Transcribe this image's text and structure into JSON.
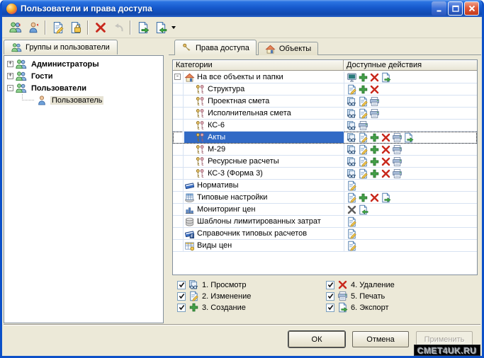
{
  "window": {
    "title": "Пользователи и права доступа"
  },
  "titlebar_buttons": [
    {
      "name": "minimize"
    },
    {
      "name": "maximize"
    },
    {
      "name": "close"
    }
  ],
  "toolbar": {
    "items": [
      {
        "icon": "add-group",
        "name": "add-group"
      },
      {
        "icon": "add-user",
        "name": "add-user"
      },
      {
        "type": "sep"
      },
      {
        "icon": "edit",
        "name": "edit-rights"
      },
      {
        "icon": "lock",
        "name": "lock-rights"
      },
      {
        "type": "sep"
      },
      {
        "icon": "delete",
        "name": "delete"
      },
      {
        "icon": "undo",
        "name": "undo",
        "disabled": true
      },
      {
        "type": "sep"
      },
      {
        "icon": "export",
        "name": "export"
      },
      {
        "icon": "import",
        "name": "import"
      },
      {
        "type": "arrow"
      }
    ]
  },
  "left_panel": {
    "tab": {
      "label": "Группы и пользователи",
      "icon": "users"
    },
    "tree": [
      {
        "label": "Администраторы",
        "icon": "users",
        "expander": "+",
        "level": 0,
        "bold": true
      },
      {
        "label": "Гости",
        "icon": "users",
        "expander": "+",
        "level": 0,
        "bold": true
      },
      {
        "label": "Пользователи",
        "icon": "users",
        "expander": "-",
        "level": 0,
        "bold": true
      },
      {
        "label": "Пользователь",
        "icon": "user",
        "level": 1,
        "selected": true
      }
    ]
  },
  "right_panel": {
    "tabs": [
      {
        "label": "Права доступа",
        "icon": "key",
        "name": "access-rights",
        "active": true
      },
      {
        "label": "Объекты",
        "icon": "home",
        "name": "objects",
        "active": false
      }
    ],
    "grid": {
      "columns": [
        "Категории",
        "Доступные действия"
      ],
      "rows": [
        {
          "label": "На все объекты и папки",
          "icon": "home",
          "expander": "-",
          "level": 0,
          "actions": [
            "monitor",
            "create",
            "delete",
            "export"
          ]
        },
        {
          "label": "Структура",
          "icon": "keys",
          "level": 1,
          "actions": [
            "edit",
            "create",
            "delete"
          ]
        },
        {
          "label": "Проектная смета",
          "icon": "keys",
          "level": 1,
          "actions": [
            "view",
            "edit",
            "print"
          ]
        },
        {
          "label": "Исполнительная смета",
          "icon": "keys",
          "level": 1,
          "actions": [
            "view",
            "edit",
            "print"
          ]
        },
        {
          "label": "КС-6",
          "icon": "keys",
          "level": 1,
          "actions": [
            "view",
            "print"
          ]
        },
        {
          "label": "Акты",
          "icon": "keys",
          "level": 1,
          "selected": true,
          "actions": [
            "view",
            "edit",
            "create",
            "delete",
            "print",
            "export"
          ]
        },
        {
          "label": "М-29",
          "icon": "keys",
          "level": 1,
          "actions": [
            "view",
            "edit",
            "create",
            "delete",
            "print"
          ]
        },
        {
          "label": "Ресурсные расчеты",
          "icon": "keys",
          "level": 1,
          "actions": [
            "view",
            "edit",
            "create",
            "delete",
            "print"
          ]
        },
        {
          "label": "КС-3 (Форма 3)",
          "icon": "keys",
          "level": 1,
          "actions": [
            "view",
            "edit",
            "create",
            "delete",
            "print"
          ]
        },
        {
          "label": "Нормативы",
          "icon": "book",
          "level": 0,
          "actions": [
            "edit"
          ]
        },
        {
          "label": "Типовые настройки",
          "icon": "card",
          "level": 0,
          "actions": [
            "edit",
            "create",
            "delete",
            "export"
          ]
        },
        {
          "label": "Мониторинг цен",
          "icon": "chart",
          "level": 0,
          "actions": [
            "delete-gray",
            "import"
          ]
        },
        {
          "label": "Шаблоны лимитированных затрат",
          "icon": "db",
          "level": 0,
          "actions": [
            "edit"
          ]
        },
        {
          "label": "Справочник типовых расчетов",
          "icon": "bookf",
          "level": 0,
          "actions": [
            "edit"
          ]
        },
        {
          "label": "Виды цен",
          "icon": "pricetable",
          "level": 0,
          "actions": [
            "edit"
          ]
        }
      ]
    },
    "legend": [
      {
        "label": "1. Просмотр",
        "icon": "view",
        "checked": true
      },
      {
        "label": "2. Изменение",
        "icon": "edit",
        "checked": true
      },
      {
        "label": "3. Создание",
        "icon": "create",
        "checked": true
      },
      {
        "label": "4. Удаление",
        "icon": "delete",
        "checked": true
      },
      {
        "label": "5. Печать",
        "icon": "print",
        "checked": true
      },
      {
        "label": "6. Экспорт",
        "icon": "export",
        "checked": true
      }
    ]
  },
  "footer": {
    "ok": "ОК",
    "cancel": "Отмена",
    "apply": "Применить"
  },
  "watermark": "CMET4UK.RU",
  "colors": {
    "selection": "#316ac5",
    "beige": "#ece9d8",
    "titlebar": "#1658c8",
    "window_border": "#0c50c8"
  }
}
